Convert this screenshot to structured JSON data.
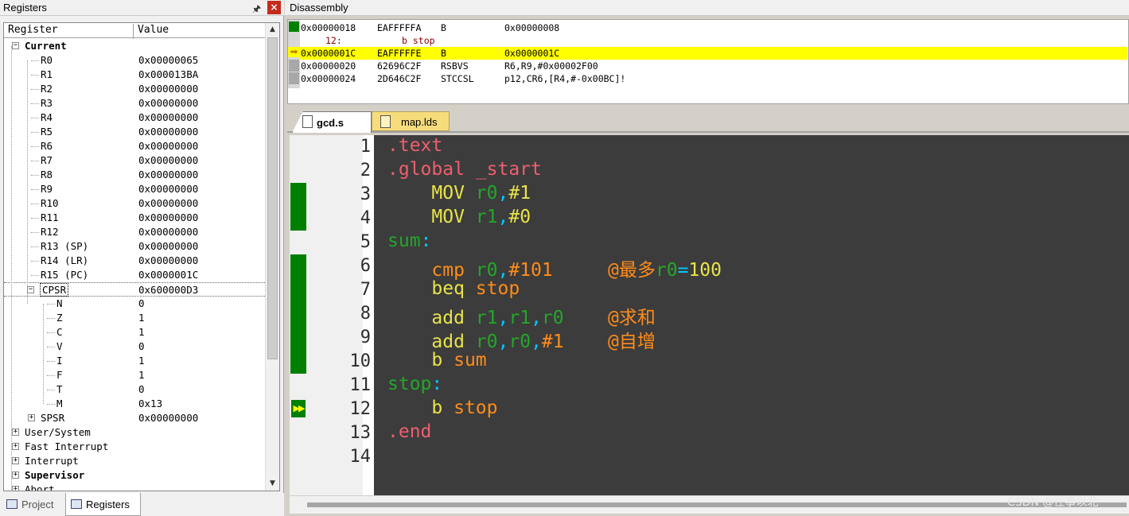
{
  "registers_panel": {
    "title": "Registers",
    "pin_icon": "pin-icon",
    "close_label": "×",
    "col_register": "Register",
    "col_value": "Value",
    "current_label": "Current",
    "registers": [
      {
        "name": "R0",
        "value": "0x00000065"
      },
      {
        "name": "R1",
        "value": "0x000013BA"
      },
      {
        "name": "R2",
        "value": "0x00000000"
      },
      {
        "name": "R3",
        "value": "0x00000000"
      },
      {
        "name": "R4",
        "value": "0x00000000"
      },
      {
        "name": "R5",
        "value": "0x00000000"
      },
      {
        "name": "R6",
        "value": "0x00000000"
      },
      {
        "name": "R7",
        "value": "0x00000000"
      },
      {
        "name": "R8",
        "value": "0x00000000"
      },
      {
        "name": "R9",
        "value": "0x00000000"
      },
      {
        "name": "R10",
        "value": "0x00000000"
      },
      {
        "name": "R11",
        "value": "0x00000000"
      },
      {
        "name": "R12",
        "value": "0x00000000"
      },
      {
        "name": "R13 (SP)",
        "value": "0x00000000"
      },
      {
        "name": "R14 (LR)",
        "value": "0x00000000"
      },
      {
        "name": "R15 (PC)",
        "value": "0x0000001C"
      }
    ],
    "cpsr": {
      "name": "CPSR",
      "value": "0x600000D3"
    },
    "cpsr_bits": [
      {
        "name": "N",
        "value": "0"
      },
      {
        "name": "Z",
        "value": "1"
      },
      {
        "name": "C",
        "value": "1"
      },
      {
        "name": "V",
        "value": "0"
      },
      {
        "name": "I",
        "value": "1"
      },
      {
        "name": "F",
        "value": "1"
      },
      {
        "name": "T",
        "value": "0"
      },
      {
        "name": "M",
        "value": "0x13"
      }
    ],
    "spsr": {
      "name": "SPSR",
      "value": "0x00000000"
    },
    "modes": [
      "User/System",
      "Fast Interrupt",
      "Interrupt",
      "Supervisor",
      "Abort"
    ],
    "tabs": {
      "project": "Project",
      "registers": "Registers"
    }
  },
  "disassembly": {
    "title": "Disassembly",
    "lines": [
      {
        "addr": "0x00000018",
        "code": "EAFFFFFA",
        "mn": "B",
        "ops": "0x00000008",
        "type": "asm"
      },
      {
        "addr": "12:",
        "code": "b stop",
        "mn": "",
        "ops": "",
        "type": "src"
      },
      {
        "addr": "0x0000001C",
        "code": "EAFFFFFE",
        "mn": "B",
        "ops": "0x0000001C",
        "type": "current"
      },
      {
        "addr": "0x00000020",
        "code": "62696C2F",
        "mn": "RSBVS",
        "ops": "R6,R9,#0x00002F00",
        "type": "asm"
      },
      {
        "addr": "0x00000024",
        "code": "2D646C2F",
        "mn": "STCCSL",
        "ops": "p12,CR6,[R4,#-0x00BC]!",
        "type": "asm"
      }
    ]
  },
  "editor": {
    "tabs": [
      {
        "label": "gcd.s"
      },
      {
        "label": "map.lds"
      }
    ],
    "line_numbers": [
      "1",
      "2",
      "3",
      "4",
      "5",
      "6",
      "7",
      "8",
      "9",
      "10",
      "11",
      "12",
      "13",
      "14"
    ],
    "code": {
      "l1": ".text",
      "l2": ".global _start",
      "l3_ins": "MOV",
      "l3_reg": "r0",
      "l3_imm": "#1",
      "l4_ins": "MOV",
      "l4_reg": "r1",
      "l4_imm": "#0",
      "l5": "sum",
      "l6_ins": "cmp",
      "l6_reg": "r0",
      "l6_imm": "#101",
      "l6_cmt_a": "@最多",
      "l6_cmt_reg": "r0",
      "l6_cmt_eq": "=",
      "l6_cmt_num": "100",
      "l7_ins": "beq",
      "l7_ref": "stop",
      "l8_ins": "add",
      "l8_r1": "r1",
      "l8_r2": "r1",
      "l8_r3": "r0",
      "l8_cmt": "@求和",
      "l9_ins": "add",
      "l9_r1": "r0",
      "l9_r2": "r0",
      "l9_imm": "#1",
      "l9_cmt": "@自增",
      "l10_ins": "b",
      "l10_ref": "sum",
      "l11": "stop",
      "l12_ins": "b",
      "l12_ref": "stop",
      "l13": ".end"
    }
  },
  "watermark": "CSDN @往事以北"
}
